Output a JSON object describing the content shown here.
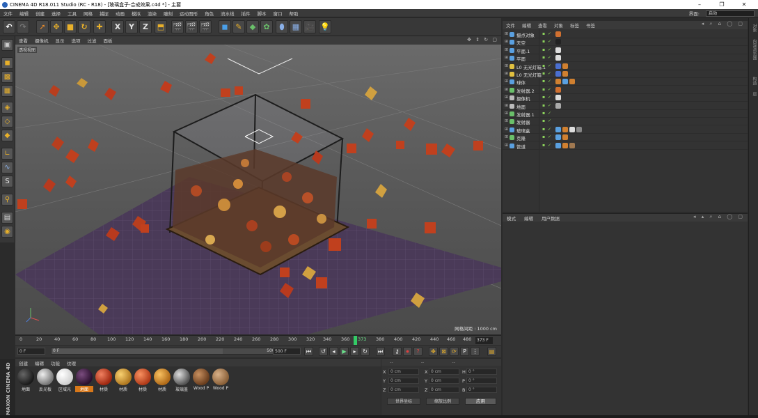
{
  "window": {
    "title": "CINEMA 4D R18.011 Studio (RC - R18) - [玻璃盒子-合成效果.c4d *] - 主要",
    "controls": [
      "–",
      "❐",
      "✕"
    ]
  },
  "menu": [
    "文件",
    "编辑",
    "创建",
    "选择",
    "工具",
    "网格",
    "捕捉",
    "动画",
    "模拟",
    "渲染",
    "雕刻",
    "运动图形",
    "角色",
    "流水线",
    "插件",
    "脚本",
    "窗口",
    "帮助"
  ],
  "layout": {
    "label": "界面:",
    "value": "启动"
  },
  "viewport": {
    "menu": [
      "查看",
      "摄像机",
      "显示",
      "选项",
      "过滤",
      "面板"
    ],
    "name": "透视视图",
    "grid_label": "网格间距 : 1000 cm"
  },
  "timeline": {
    "ticks": [
      "0",
      "20",
      "40",
      "60",
      "80",
      "100",
      "120",
      "140",
      "160",
      "180",
      "200",
      "220",
      "240",
      "260",
      "280",
      "300",
      "320",
      "340",
      "360",
      "380",
      "400",
      "420",
      "440",
      "460",
      "480",
      "500"
    ],
    "marker": "373",
    "current_frame": "373 F"
  },
  "transport": {
    "start": "0 F",
    "range_start": "0 F",
    "range_end": "500 F",
    "end": "500 F",
    "progress": 0.75
  },
  "materials": {
    "tabs": [
      "创建",
      "编辑",
      "功能",
      "纹理"
    ],
    "items": [
      {
        "name": "地面",
        "color": "#1a1a1a"
      },
      {
        "name": "反光板",
        "color": "#8a8a8a"
      },
      {
        "name": "区域光",
        "color": "#e6e6e6"
      },
      {
        "name": "地面",
        "color": "#3a1e3e",
        "selected": true
      },
      {
        "name": "材质",
        "color": "#c83a1e"
      },
      {
        "name": "材质",
        "color": "#d4a23a"
      },
      {
        "name": "材质",
        "color": "#d85a28"
      },
      {
        "name": "材质",
        "color": "#d8902a"
      },
      {
        "name": "玻璃盖",
        "color": "#9a9a9a"
      },
      {
        "name": "Wood P",
        "color": "#8a5a32"
      },
      {
        "name": "Wood P",
        "color": "#a07850"
      }
    ]
  },
  "coords": {
    "header": [
      "--",
      "--",
      "--"
    ],
    "rows": [
      {
        "a1": "X",
        "v1": "0 cm",
        "a2": "X",
        "v2": "0 cm",
        "a3": "H",
        "v3": "0 °"
      },
      {
        "a1": "Y",
        "v1": "0 cm",
        "a2": "Y",
        "v2": "0 cm",
        "a3": "P",
        "v3": "0 °"
      },
      {
        "a1": "Z",
        "v1": "0 cm",
        "a2": "Z",
        "v2": "0 cm",
        "a3": "B",
        "v3": "0 °"
      }
    ],
    "mode1": "世界坐标",
    "mode2": "缩放比例",
    "apply": "应用"
  },
  "object_manager": {
    "tabs": [
      "文件",
      "编辑",
      "查看",
      "对象",
      "标签",
      "书签"
    ],
    "objects": [
      {
        "name": "摄点对象",
        "icon": "#5aa0e0",
        "tags": [
          "#d07030"
        ]
      },
      {
        "name": "天空",
        "icon": "#5aa0e0",
        "tags": [
          "#222222"
        ]
      },
      {
        "name": "平面.1",
        "icon": "#5aa0e0",
        "tags": [
          "#dddddd"
        ]
      },
      {
        "name": "平面",
        "icon": "#5aa0e0",
        "tags": [
          "#dddddd"
        ]
      },
      {
        "name": "L0 无光灯箱.1",
        "icon": "#e0c040",
        "tags": [
          "#4a6fd0",
          "#d08030"
        ]
      },
      {
        "name": "L0 无光灯箱",
        "icon": "#e0c040",
        "tags": [
          "#4a6fd0",
          "#d08030"
        ]
      },
      {
        "name": "球体",
        "icon": "#5aa0e0",
        "tags": [
          "#d08030",
          "#5aa0e0",
          "#d08030"
        ]
      },
      {
        "name": "发射器.2",
        "icon": "#6ac06a",
        "tags": [
          "#d07030"
        ]
      },
      {
        "name": "摄像机",
        "icon": "#bbbbbb",
        "tags": [
          "#dddddd"
        ]
      },
      {
        "name": "地面",
        "icon": "#bbbbbb",
        "tags": [
          "#aaaaaa",
          "#333333"
        ]
      },
      {
        "name": "发射器.1",
        "icon": "#6ac06a",
        "tags": []
      },
      {
        "name": "发射器",
        "icon": "#6ac06a",
        "tags": []
      },
      {
        "name": "玻璃盒",
        "icon": "#5aa0e0",
        "tags": [
          "#5aa0e0",
          "#d08030",
          "#dddddd",
          "#888888"
        ]
      },
      {
        "name": "克隆",
        "icon": "#6ac06a",
        "tags": [
          "#5aa0e0",
          "#d08030"
        ]
      },
      {
        "name": "管道",
        "icon": "#5aa0e0",
        "tags": [
          "#5aa0e0",
          "#d08030",
          "#a07850"
        ]
      }
    ]
  },
  "attributes": {
    "tabs": [
      "模式",
      "编辑",
      "用户数据"
    ]
  },
  "side_strip": [
    "对象",
    "内容浏览器",
    "构造",
    "层"
  ]
}
